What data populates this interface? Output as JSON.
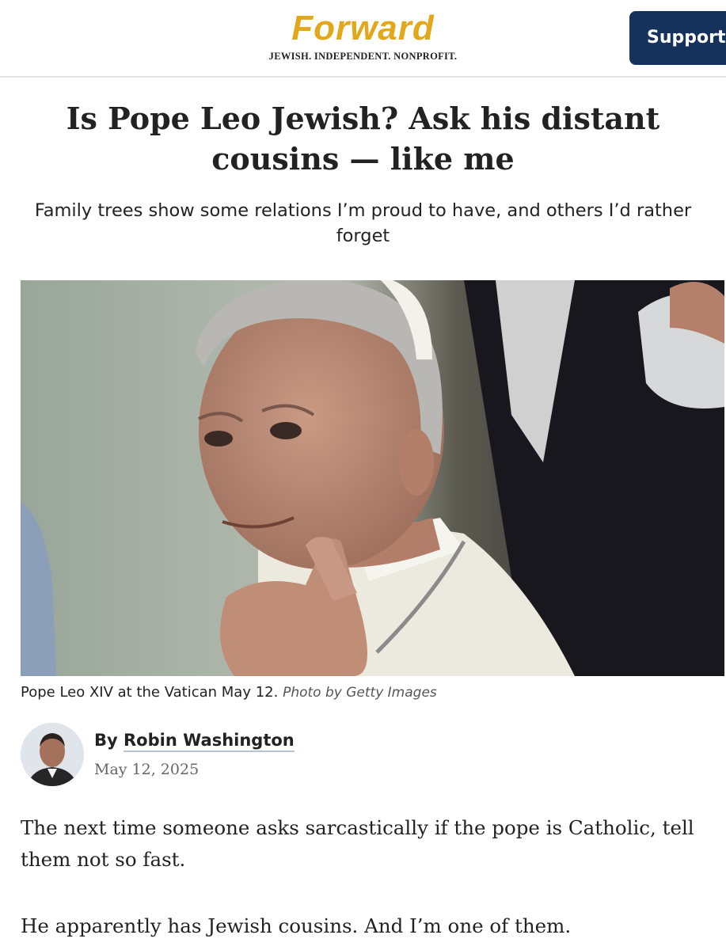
{
  "header": {
    "logo_text": "Forward",
    "tagline": "JEWISH. INDEPENDENT. NONPROFIT.",
    "support_label": "Support"
  },
  "article": {
    "headline": "Is Pope Leo Jewish? Ask his distant cousins — like me",
    "dek": "Family trees show some relations I’m proud to have, and others I’d rather forget",
    "caption": "Pope Leo XIV at the Vatican May 12.",
    "photo_credit": "Photo by Getty Images",
    "byline_prefix": "By",
    "author": "Robin Washington",
    "date": "May 12, 2025",
    "paragraphs": [
      "The next time someone asks sarcastically if the pope is Catholic, tell them not so fast.",
      "He apparently has Jewish cousins. And I’m one of them."
    ]
  },
  "colors": {
    "logo": "#e2a71a",
    "support_button": "#14325c",
    "text": "#222222",
    "date": "#666666"
  },
  "icons": [
    "forward-logo",
    "author-avatar"
  ]
}
